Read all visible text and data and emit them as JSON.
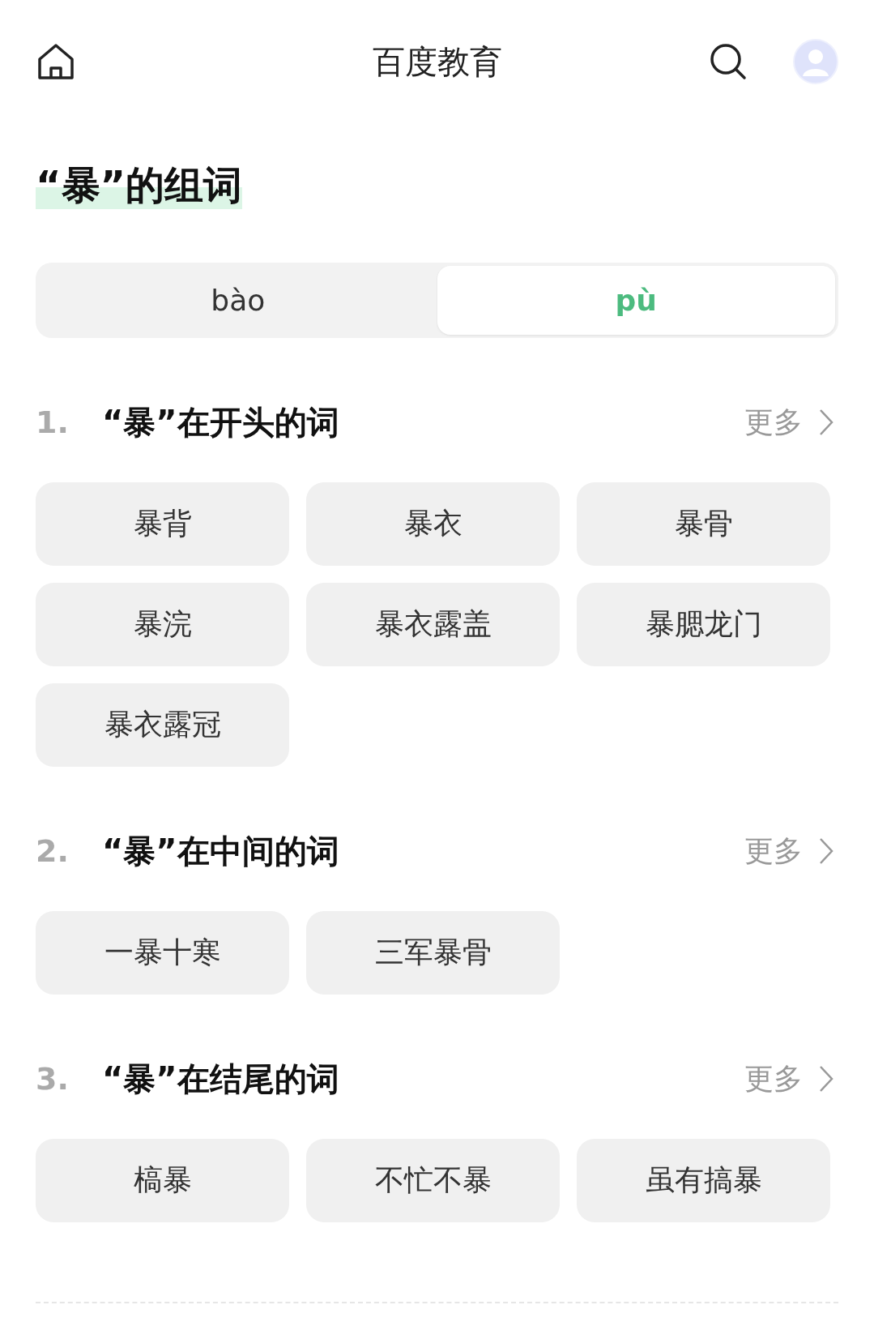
{
  "header": {
    "title": "百度教育"
  },
  "heading": "“暴”的组词",
  "tabs": [
    {
      "label": "bào",
      "selected": false
    },
    {
      "label": "pù",
      "selected": true
    }
  ],
  "sections": [
    {
      "number": "1.",
      "title": "“暴”在开头的词",
      "more": "更多",
      "words": [
        "暴背",
        "暴衣",
        "暴骨",
        "暴浣",
        "暴衣露盖",
        "暴腮龙门",
        "暴衣露冠"
      ]
    },
    {
      "number": "2.",
      "title": "“暴”在中间的词",
      "more": "更多",
      "words": [
        "一暴十寒",
        "三军暴骨"
      ]
    },
    {
      "number": "3.",
      "title": "“暴”在结尾的词",
      "more": "更多",
      "words": [
        "槁暴",
        "不忙不暴",
        "虽有搞暴"
      ]
    }
  ]
}
